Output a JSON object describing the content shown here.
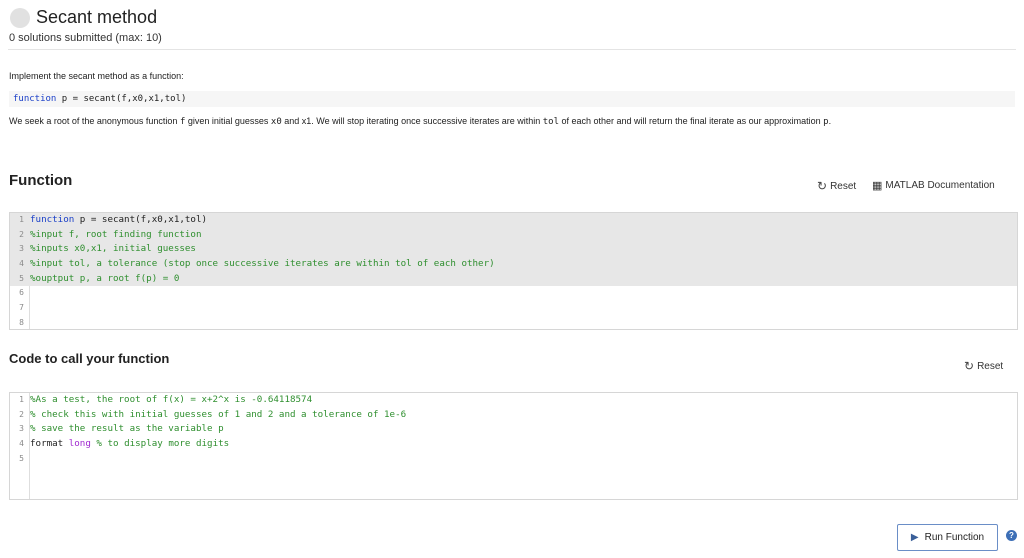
{
  "header": {
    "title": "Secant method",
    "subtitle": "0 solutions submitted (max: 10)"
  },
  "problem": {
    "intro": "Implement the secant method as a function:",
    "signature_keyword": "function",
    "signature_rest": " p = secant(f,x0,x1,tol)",
    "desc_parts": [
      {
        "t": "We seek a root of the anonymous function ",
        "code": false
      },
      {
        "t": "f",
        "code": true
      },
      {
        "t": " given initial guesses ",
        "code": false
      },
      {
        "t": "x0",
        "code": true
      },
      {
        "t": " and x1. We will stop iterating once successive iterates are within ",
        "code": false
      },
      {
        "t": "tol",
        "code": true
      },
      {
        "t": " of each other and will return the final iterate as our approximation ",
        "code": false
      },
      {
        "t": "p",
        "code": true
      },
      {
        "t": ".",
        "code": false
      }
    ]
  },
  "function_section": {
    "title": "Function",
    "reset_label": "Reset",
    "doc_label": "MATLAB Documentation",
    "lines": [
      {
        "n": "1",
        "gray": true,
        "segs": [
          {
            "t": "function",
            "c": "kw"
          },
          {
            "t": " p = secant(f,x0,x1,tol)",
            "c": "plain"
          }
        ]
      },
      {
        "n": "2",
        "gray": true,
        "segs": [
          {
            "t": "%input f, root finding function",
            "c": "comment"
          }
        ]
      },
      {
        "n": "3",
        "gray": true,
        "segs": [
          {
            "t": "%inputs x0,x1, initial guesses",
            "c": "comment"
          }
        ]
      },
      {
        "n": "4",
        "gray": true,
        "segs": [
          {
            "t": "%input tol, a tolerance (stop once successive iterates are within tol of each other)",
            "c": "comment"
          }
        ]
      },
      {
        "n": "5",
        "gray": true,
        "segs": [
          {
            "t": "%ouptput p, a root f(p) = 0",
            "c": "comment"
          }
        ]
      },
      {
        "n": "6",
        "gray": false,
        "segs": []
      },
      {
        "n": "7",
        "gray": false,
        "segs": []
      },
      {
        "n": "8",
        "gray": false,
        "segs": []
      }
    ]
  },
  "call_section": {
    "title": "Code to call your function",
    "reset_label": "Reset",
    "lines": [
      {
        "n": "1",
        "gray": false,
        "segs": [
          {
            "t": "%As a test, the root of f(x) = x+2^x is -0.64118574",
            "c": "comment"
          }
        ]
      },
      {
        "n": "2",
        "gray": false,
        "segs": [
          {
            "t": "% check this with initial guesses of 1 and 2 and a tolerance of 1e-6",
            "c": "comment"
          }
        ]
      },
      {
        "n": "3",
        "gray": false,
        "segs": [
          {
            "t": "% save the result as the variable p",
            "c": "comment"
          }
        ]
      },
      {
        "n": "4",
        "gray": false,
        "segs": [
          {
            "t": "format",
            "c": "plain"
          },
          {
            "t": " long",
            "c": "purple"
          },
          {
            "t": " % to display more digits",
            "c": "comment"
          }
        ]
      },
      {
        "n": "5",
        "gray": false,
        "segs": []
      }
    ]
  },
  "actions": {
    "run_label": "Run Function",
    "help_glyph": "?"
  },
  "icons": {
    "status": "status-circle-icon",
    "reset": "refresh-icon",
    "doc": "book-icon",
    "run": "play-icon",
    "help": "help-icon"
  }
}
